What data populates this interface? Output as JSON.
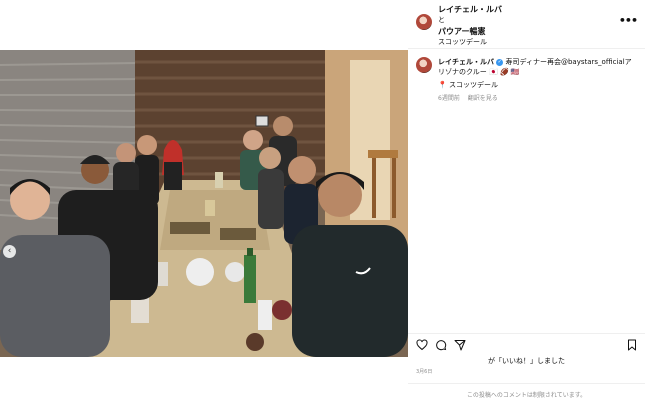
{
  "header": {
    "account_name": "レイチェル・ルバ",
    "connector": "と",
    "collab_account": "パウアー暢憲",
    "location": "スコッツデール"
  },
  "caption": {
    "account_name": "レイチェル・ルバ",
    "text": "寿司ディナー再会@baystars_officialアリゾナのクルー",
    "emoji_text": "🇯🇵 🏈 🇺🇸",
    "location_pin": "📍",
    "location": "スコッツデール",
    "time_ago": "6週間前",
    "translate_label": "翻訳を見る"
  },
  "likes_text": "が「いいね！」しました",
  "date_text": "3月6日",
  "footer_text": "この投稿へのコメントは制限されています。",
  "icons": [
    "heart-icon",
    "comment-icon",
    "share-icon",
    "bookmark-icon",
    "more-icon",
    "chevron-left-icon"
  ]
}
